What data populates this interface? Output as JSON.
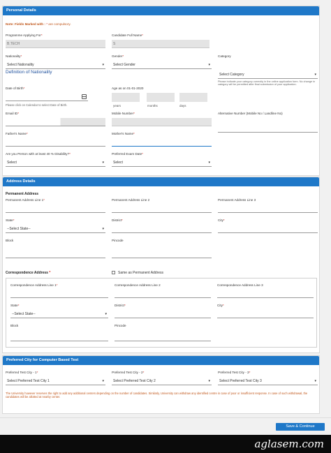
{
  "personal": {
    "header": "Personal Details",
    "note_prefix": "Note: Fields Marked with :",
    "note_star": "*",
    "note_suffix": "are compulsory.",
    "programme_label": "Programme Applying For",
    "programme_value": "B.TECH",
    "fullname_label": "Candidate Full Name",
    "fullname_value": "S",
    "nationality_label": "Nationality",
    "nationality_value": "Select Nationality",
    "nationality_definition": "Definition of Nationality",
    "gender_label": "Gender",
    "gender_value": "Select Gender",
    "category_label": "Category",
    "category_value": "Select Category",
    "category_note": "Please indicate your category correctly in the online application form. No change in category will be permitted after final submission of your application.",
    "dob_label": "Date of Birth",
    "dob_note": "Please click on Calendar to select Date of Birth.",
    "age_label": "Age as on 01-01-2020",
    "age_years": "years",
    "age_months": "months",
    "age_days": "days",
    "email_label": "Email ID",
    "mobile_label": "Mobile Number",
    "alt_mobile_label": "Alternative Number (Mobile No / Landline No)",
    "father_label": "Father's Name",
    "mother_label": "Mother's Name",
    "disability_label": "Are you Person with at least 40 % Disability?",
    "disability_value": "Select",
    "exam_date_label": "Preferred Exam Date",
    "exam_date_value": "Select",
    "star": "*"
  },
  "address": {
    "header": "Address Details",
    "permanent_title": "Permanent Address",
    "perm_line1_label": "Permanent Address Line 1",
    "perm_line2_label": "Permanent Address Line 2",
    "perm_line3_label": "Permanent Address Line 3",
    "state_label": "State",
    "state_value": "--Select State--",
    "district_label": "District",
    "city_label": "City",
    "block_label": "Block",
    "pincode_label": "Pincode",
    "corr_title": "Correspondence Address",
    "same_as_label": "Same as Permanent Address",
    "corr_line1_label": "Correspondence Address Line 1",
    "corr_line2_label": "Correspondence Address Line 2",
    "corr_line3_label": "Correspondence Address Line 3",
    "corr_state_label": "State",
    "corr_state_value": "--Select State--",
    "corr_district_label": "District",
    "corr_city_label": "City",
    "corr_block_label": "Block",
    "corr_pincode_label": "Pincode"
  },
  "city": {
    "header": "Preferred City for Computer Based Test",
    "c1_label": "Preferred Test City - 1",
    "c1_value": "Select Preferred Test City 1",
    "c2_label": "Preferred Test City - 2",
    "c2_value": "Select Preferred Test City 2",
    "c3_label": "Preferred Test City - 3",
    "c3_value": "Select Preferred Test City 3",
    "note": "The University however reserves the right to add any additional centers depending on the number of candidates. Similarly, University can withdraw any identified centre in case of poor or insufficient response. In case of such withdrawal, the candidates will be allotted at nearby center."
  },
  "footer": {
    "save_label": "Save & Continue",
    "brand": "aglasem.com"
  },
  "colors": {
    "accent": "#1f78c8",
    "required": "#d9251b",
    "note": "#c0561a"
  }
}
